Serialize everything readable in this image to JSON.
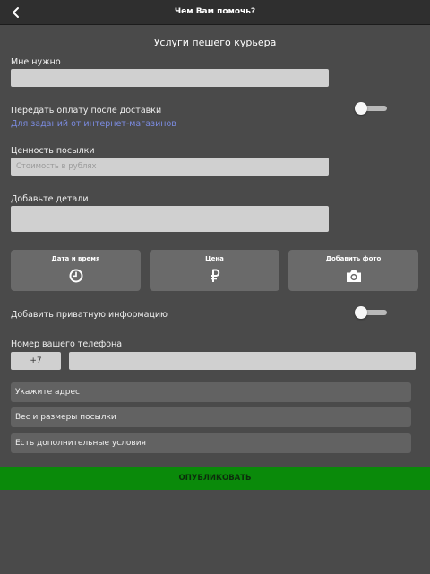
{
  "header": {
    "title": "Чем Вам помочь?"
  },
  "section": {
    "title": "Услуги пешего курьера"
  },
  "need": {
    "label": "Мне нужно",
    "value": "",
    "placeholder": ""
  },
  "payment": {
    "label": "Передать оплату после доставки",
    "link": "Для заданий от интернет-магазинов",
    "toggle_on": false
  },
  "value_field": {
    "label": "Ценность посылки",
    "value": "",
    "placeholder": "Стоимость в рублях"
  },
  "details": {
    "label": "Добавьте детали",
    "value": "",
    "placeholder": ""
  },
  "tiles": [
    {
      "label": "Дата и время",
      "icon": "clock-icon"
    },
    {
      "label": "Цена",
      "icon": "ruble-icon"
    },
    {
      "label": "Добавить фото",
      "icon": "camera-icon"
    }
  ],
  "private_info": {
    "label": "Добавить приватную информацию",
    "toggle_on": false
  },
  "phone": {
    "label": "Номер вашего телефона",
    "code": "+7",
    "value": "",
    "placeholder": ""
  },
  "options": [
    {
      "label": "Укажите адрес"
    },
    {
      "label": "Вес и размеры посылки"
    },
    {
      "label": "Есть дополнительные условия"
    }
  ],
  "publish": {
    "label": "ОПУБЛИКОВАТЬ"
  },
  "colors": {
    "background": "#4a4a4a",
    "topbar": "#2f2f2f",
    "link": "#7b8be0",
    "publish": "#0a8a0a",
    "input": "#d0d0d0"
  }
}
